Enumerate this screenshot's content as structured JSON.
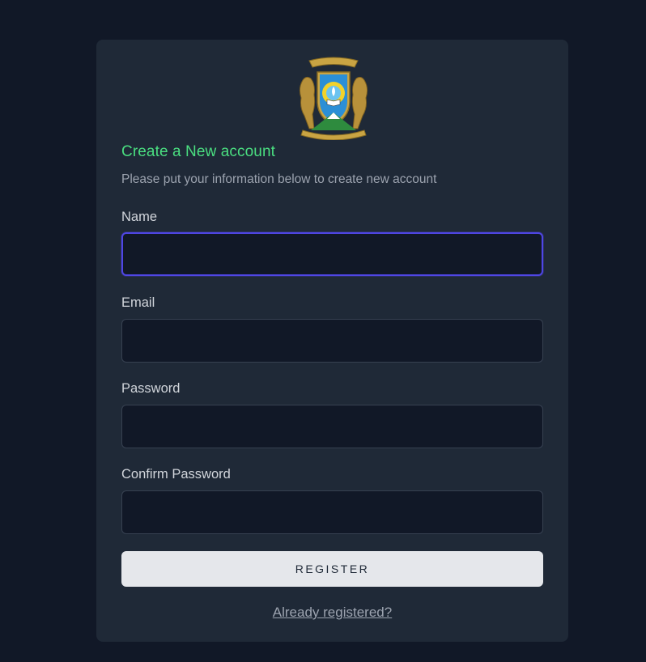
{
  "header": {
    "title": "Create a New account",
    "subtitle": "Please put your information below to create new account",
    "logo_icon": "university-crest-logo"
  },
  "form": {
    "name": {
      "label": "Name",
      "value": "",
      "placeholder": ""
    },
    "email": {
      "label": "Email",
      "value": "",
      "placeholder": ""
    },
    "password": {
      "label": "Password",
      "value": "",
      "placeholder": ""
    },
    "confirm_password": {
      "label": "Confirm Password",
      "value": "",
      "placeholder": ""
    },
    "submit_label": "Register",
    "login_link": "Already registered?"
  },
  "colors": {
    "page_background": "#111827",
    "card_background": "#1f2937",
    "accent_title": "#4ade80",
    "focus_ring": "#4f46e5",
    "button_background": "#e5e7eb"
  }
}
